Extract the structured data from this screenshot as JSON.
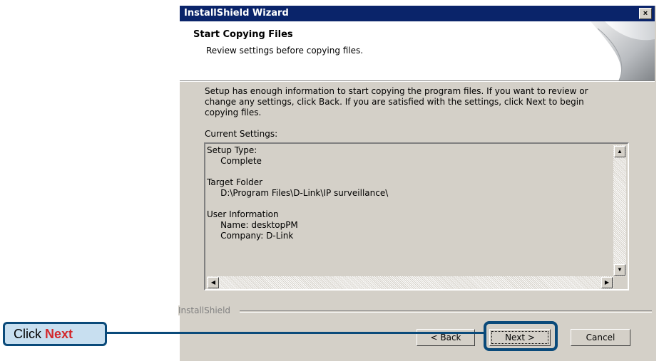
{
  "window": {
    "title": "InstallShield Wizard",
    "close_label": "×"
  },
  "header": {
    "title": "Start Copying Files",
    "subtitle": "Review settings before copying files."
  },
  "body": {
    "intro": "Setup has enough information to start copying the program files.  If you want to review or change any settings, click Back.  If you are satisfied with the settings, click Next to begin copying files.",
    "current_settings_label": "Current Settings:",
    "settings_text": "Setup Type:\n     Complete\n\nTarget Folder\n     D:\\Program Files\\D-Link\\IP surveillance\\\n\nUser Information\n     Name: desktopPM\n     Company: D-Link"
  },
  "footer": {
    "brand": "InstallShield",
    "back_label": "< Back",
    "next_label": "Next >",
    "cancel_label": "Cancel"
  },
  "annotation": {
    "prefix": "Click",
    "emphasis": "Next"
  },
  "colors": {
    "titlebar": "#0a246a",
    "dialog_bg": "#d4d0c8",
    "callout_border": "#0a4a7a",
    "callout_fill": "#c8dff0",
    "emphasis": "#d3282c"
  },
  "icons": [
    "close-icon",
    "scroll-up-icon",
    "scroll-down-icon",
    "scroll-left-icon",
    "scroll-right-icon"
  ]
}
